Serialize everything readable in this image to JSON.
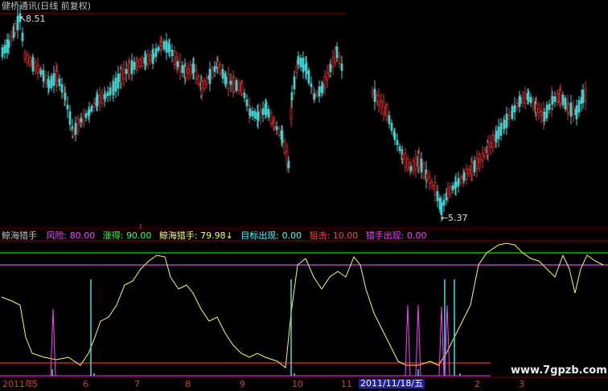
{
  "header": {
    "title": "健桥通讯(日线 前复权)",
    "title_color": "#c0c0c0"
  },
  "main_chart": {
    "high_label": "8.51",
    "low_label": "5.37",
    "up_color": "#e03030",
    "down_color": "#40d0d0",
    "grid_color": "#800000"
  },
  "indicator_panel": {
    "name": "鲸海猎手",
    "params": [
      {
        "label": "风险:",
        "value": "80.00",
        "color": "#ff40ff"
      },
      {
        "label": "涨得:",
        "value": "90.00",
        "color": "#40ff40"
      },
      {
        "label": "鲸海猎手:",
        "value": "79.98",
        "arrow": "↓",
        "color": "#ffff40"
      },
      {
        "label": "目标出现:",
        "value": "0.00",
        "color": "#40ffff"
      },
      {
        "label": "狙击:",
        "value": "10.00",
        "color": "#ff4040"
      },
      {
        "label": "猎手出现:",
        "value": "0.00",
        "color": "#ff40ff"
      }
    ],
    "line_color": "#ffff40",
    "upper_line_color": "#00dd00",
    "purple_line_color": "#dd40ff",
    "lower_line_color": "#ff2020",
    "cyan_spike_color": "#40e0e0",
    "magenta_spike_color": "#ff40ff"
  },
  "time_axis": {
    "labels": [
      "2011年",
      "5",
      "6",
      "7",
      "8",
      "9",
      "10",
      "11",
      "2",
      "3"
    ],
    "cursor_date": "2011/11/18/五",
    "color": "#d04040"
  },
  "watermark": "www.7gpzb.com"
}
